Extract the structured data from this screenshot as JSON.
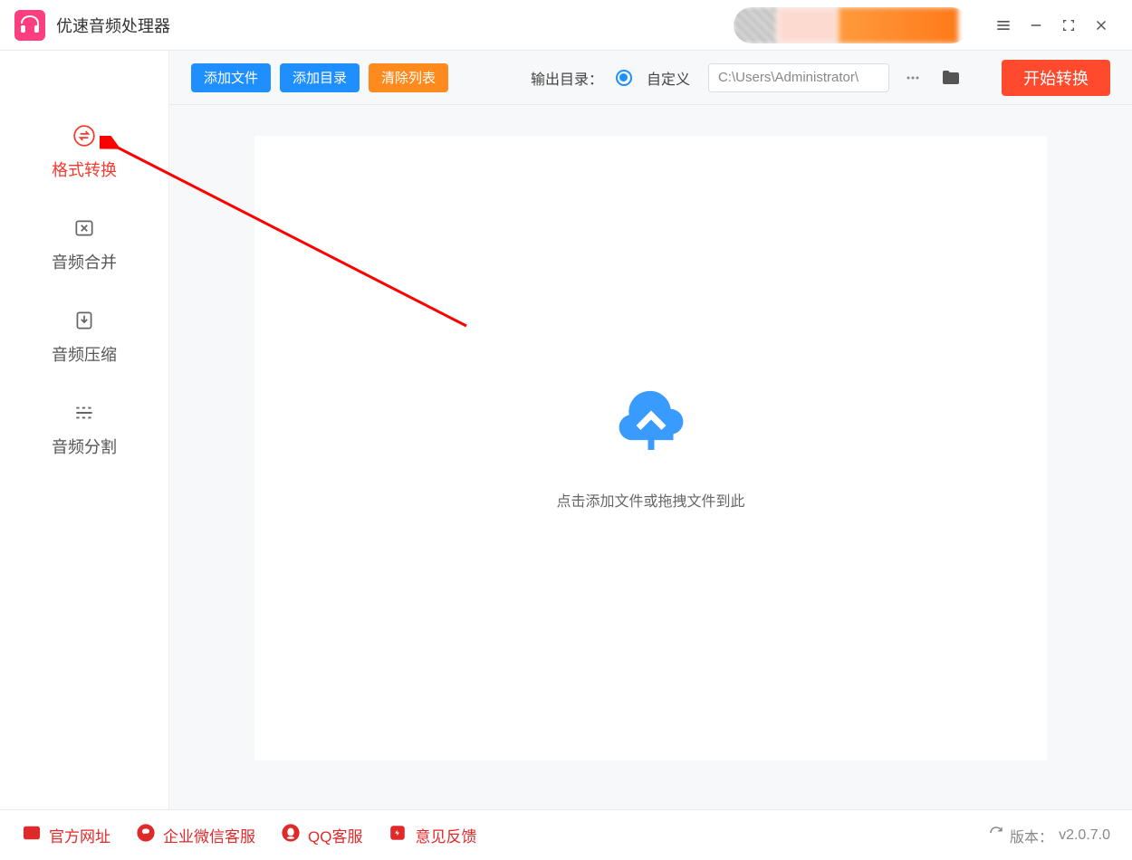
{
  "app": {
    "title": "优速音频处理器"
  },
  "sidebar": {
    "items": [
      {
        "label": "格式转换"
      },
      {
        "label": "音频合并"
      },
      {
        "label": "音频压缩"
      },
      {
        "label": "音频分割"
      }
    ]
  },
  "toolbar": {
    "add_file": "添加文件",
    "add_dir": "添加目录",
    "clear_list": "清除列表",
    "output_label": "输出目录：",
    "custom_label": "自定义",
    "path_value": "C:\\Users\\Administrator\\",
    "start": "开始转换"
  },
  "dropzone": {
    "hint": "点击添加文件或拖拽文件到此"
  },
  "footer": {
    "links": [
      {
        "label": "官方网址"
      },
      {
        "label": "企业微信客服"
      },
      {
        "label": "QQ客服"
      },
      {
        "label": "意见反馈"
      }
    ],
    "version_prefix": "版本：",
    "version": "v2.0.7.0"
  }
}
